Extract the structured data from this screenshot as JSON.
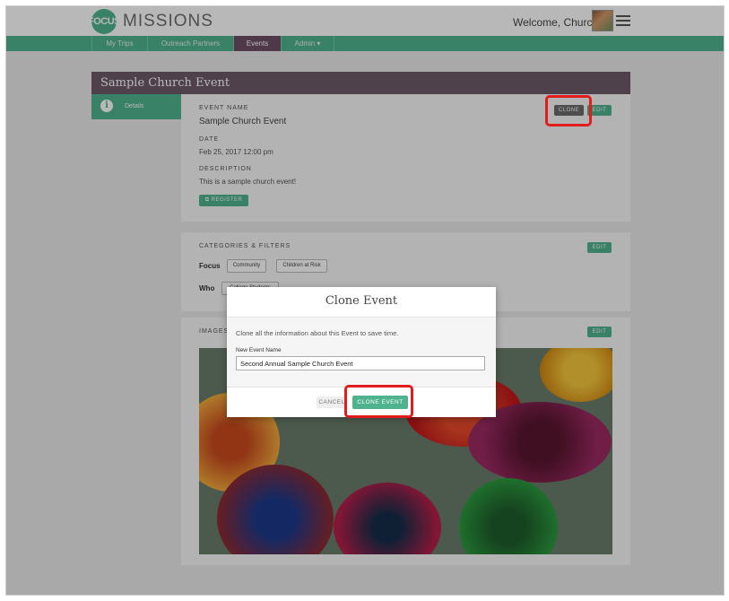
{
  "header": {
    "logo_mark": "FOCUS",
    "logo_text": "MISSIONS",
    "welcome": "Welcome, Church!"
  },
  "nav": {
    "items": [
      {
        "label": "My Trips"
      },
      {
        "label": "Outreach Partners"
      },
      {
        "label": "Events"
      },
      {
        "label": "Admin ▾"
      }
    ],
    "active": "Events"
  },
  "card": {
    "title": "Sample Church Event",
    "side_tab": "Details"
  },
  "details": {
    "event_name_label": "EVENT NAME",
    "event_name": "Sample Church Event",
    "date_label": "DATE",
    "date": "Feb 25, 2017 12:00 pm",
    "description_label": "DESCRIPTION",
    "description": "This is a sample church event!",
    "register_button": "⧉ REGISTER",
    "clone_button": "CLONE",
    "edit_button": "EDIT"
  },
  "categories": {
    "heading": "CATEGORIES & FILTERS",
    "edit_button": "EDIT",
    "focus_label": "Focus",
    "focus_tags": [
      "Community",
      "Children at Risk"
    ],
    "who_label": "Who",
    "who_tags": [
      "College Students"
    ]
  },
  "images": {
    "heading": "IMAGES",
    "edit_button": "EDIT"
  },
  "modal": {
    "title": "Clone Event",
    "description": "Clone all the information about this Event to save time.",
    "field_label": "New Event Name",
    "field_value": "Second Annual Sample Church Event",
    "cancel_button": "CANCEL",
    "submit_button": "CLONE EVENT"
  },
  "colors": {
    "brand_green": "#4fb38f",
    "title_bar": "#6e5a6a",
    "active_nav": "#6e4f66",
    "highlight": "#e01c1c"
  },
  "icons": {
    "info": "info-circle-icon",
    "menu": "hamburger-menu-icon",
    "external": "external-link-icon"
  }
}
